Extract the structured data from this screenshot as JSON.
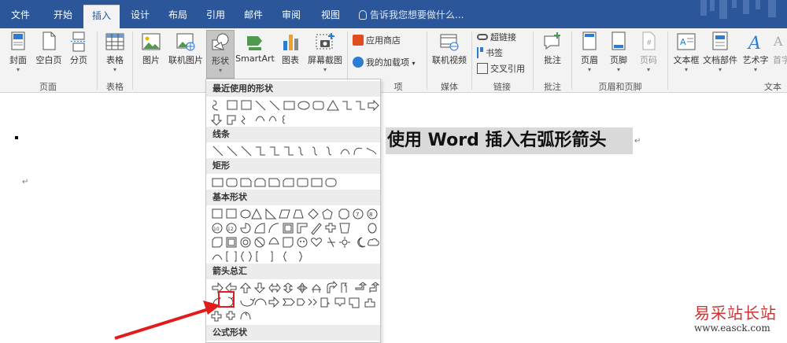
{
  "tabs": [
    "文件",
    "开始",
    "插入",
    "设计",
    "布局",
    "引用",
    "邮件",
    "审阅",
    "视图"
  ],
  "active_tab": "插入",
  "tellme": "告诉我您想要做什么...",
  "ribbon": {
    "pages": {
      "cover": "封面",
      "blank": "空白页",
      "break": "分页",
      "group": "页面"
    },
    "tables": {
      "table": "表格",
      "group": "表格"
    },
    "illustrations": {
      "picture": "图片",
      "online_picture": "联机图片",
      "shapes": "形状",
      "smartart": "SmartArt",
      "chart": "图表",
      "screenshot": "屏幕截图"
    },
    "addins": {
      "store": "应用商店",
      "my_addins": "我的加载项",
      "group_tail": "项"
    },
    "media": {
      "online_video": "联机视频",
      "group": "媒体"
    },
    "links": {
      "hyperlink": "超链接",
      "bookmark": "书签",
      "cross_ref": "交叉引用",
      "group": "链接"
    },
    "comments": {
      "comment": "批注",
      "group": "批注"
    },
    "header_footer": {
      "header": "页眉",
      "footer": "页脚",
      "page_number": "页码",
      "group": "页眉和页脚"
    },
    "text": {
      "textbox": "文本框",
      "quick_parts": "文档部件",
      "wordart": "艺术字",
      "dropcap": "首字",
      "group": "文本"
    }
  },
  "shapes_menu": {
    "categories": [
      "最近使用的形状",
      "线条",
      "矩形",
      "基本形状",
      "箭头总汇",
      "公式形状"
    ]
  },
  "document": {
    "heading": "使用 Word 插入右弧形箭头"
  },
  "watermark": {
    "title": "易采站长站",
    "url": "www.easck.com"
  },
  "colors": {
    "word_blue": "#2b579a",
    "highlight_red": "#e21b1b"
  }
}
